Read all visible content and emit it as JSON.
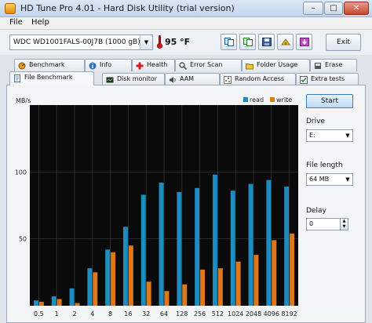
{
  "window": {
    "title": "HD Tune Pro 4.01 - Hard Disk Utility (trial version)",
    "buttons": [
      "–",
      "□",
      "✕"
    ]
  },
  "menu": {
    "items": [
      "File",
      "Help"
    ]
  },
  "toolbar": {
    "drive": "WDC WD1001FALS-00J7B   (1000 gB)",
    "temperature": "95 °F",
    "exit_label": "Exit",
    "icons": [
      "copy-text-icon",
      "copy-screenshot-icon",
      "save-icon",
      "options-icon",
      "download-icon"
    ]
  },
  "tabs": {
    "row1": [
      {
        "label": "Benchmark",
        "icon": "benchmark-icon"
      },
      {
        "label": "Info",
        "icon": "info-icon"
      },
      {
        "label": "Health",
        "icon": "health-icon"
      },
      {
        "label": "Error Scan",
        "icon": "error-scan-icon"
      },
      {
        "label": "Folder Usage",
        "icon": "folder-icon"
      },
      {
        "label": "Erase",
        "icon": "erase-icon"
      }
    ],
    "row2": [
      {
        "label": "File Benchmark",
        "icon": "file-benchmark-icon",
        "active": true
      },
      {
        "label": "Disk monitor",
        "icon": "disk-monitor-icon"
      },
      {
        "label": "AAM",
        "icon": "speaker-icon"
      },
      {
        "label": "Random Access",
        "icon": "random-access-icon"
      },
      {
        "label": "Extra tests",
        "icon": "extra-tests-icon"
      }
    ]
  },
  "side": {
    "start_label": "Start",
    "drive_label": "Drive",
    "drive_value": "E:",
    "file_length_label": "File length",
    "file_length_value": "64 MB",
    "delay_label": "Delay",
    "delay_value": "0"
  },
  "colors": {
    "read": "#1e8cc0",
    "write": "#e07818",
    "plot_bg": "#0a0a0a",
    "grid": "#3a3a3a"
  },
  "chart_data": {
    "type": "bar",
    "ylabel": "MB/s",
    "ylim": [
      0,
      150
    ],
    "yticks": [
      50,
      100
    ],
    "categories": [
      "0.5",
      "1",
      "2",
      "4",
      "8",
      "16",
      "32",
      "64",
      "128",
      "256",
      "512",
      "1024",
      "2048",
      "4096",
      "8192"
    ],
    "series": [
      {
        "name": "read",
        "values": [
          4,
          7,
          13,
          28,
          42,
          59,
          83,
          92,
          85,
          88,
          98,
          86,
          91,
          94,
          89
        ]
      },
      {
        "name": "write",
        "values": [
          3,
          5,
          2,
          25,
          40,
          45,
          18,
          11,
          16,
          27,
          28,
          33,
          38,
          49,
          54
        ]
      }
    ]
  }
}
